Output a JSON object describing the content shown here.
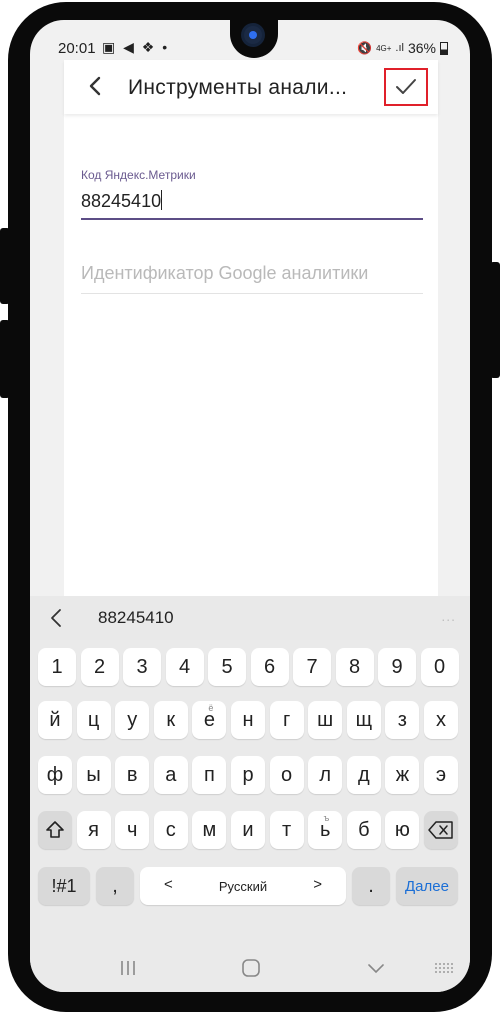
{
  "status_bar": {
    "time": "20:01",
    "left_icons": [
      "gallery-icon",
      "telegram-icon",
      "app-icon",
      "dot-icon"
    ],
    "network": "4G+",
    "battery": "36%"
  },
  "app_bar": {
    "title": "Инструменты анали...",
    "back_icon": "chevron-left-icon",
    "confirm_icon": "checkmark-icon"
  },
  "form": {
    "yandex_label": "Код Яндекс.Метрики",
    "yandex_value": "88245410",
    "google_placeholder": "Идентификатор Google аналитики"
  },
  "keyboard": {
    "suggestion": "88245410",
    "more_icon": "...",
    "row_numbers": [
      "1",
      "2",
      "3",
      "4",
      "5",
      "6",
      "7",
      "8",
      "9",
      "0"
    ],
    "row1": [
      "й",
      "ц",
      "у",
      "к",
      "е",
      "н",
      "г",
      "ш",
      "щ",
      "з",
      "х"
    ],
    "row1_hint_e": "ё",
    "row2": [
      "ф",
      "ы",
      "в",
      "а",
      "п",
      "р",
      "о",
      "л",
      "д",
      "ж",
      "э"
    ],
    "row3": [
      "я",
      "ч",
      "с",
      "м",
      "и",
      "т",
      "ь",
      "б",
      "ю"
    ],
    "row3_hint_soft": "ъ",
    "symbols_label": "!#1",
    "comma_label": ",",
    "space_label": "Русский",
    "space_left": "<",
    "space_right": ">",
    "period_label": ".",
    "done_label": "Далее"
  },
  "colors": {
    "accent": "#5c4d86",
    "highlight_border": "#e0202a",
    "done_text": "#1c6fd6"
  }
}
